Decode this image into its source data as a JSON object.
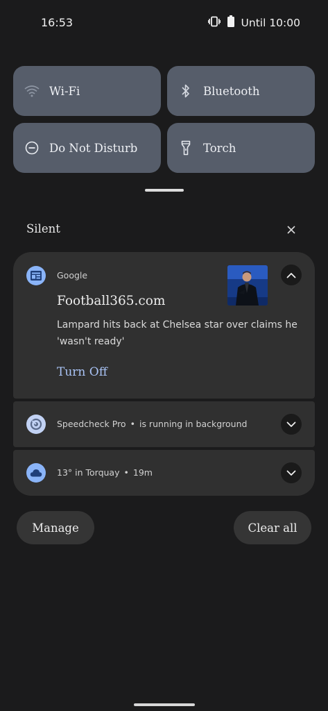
{
  "status_bar": {
    "time": "16:53",
    "battery_text": "Until 10:00",
    "vibrate_icon": "vibrate-icon",
    "battery_icon": "battery-icon"
  },
  "quick_settings": {
    "tiles": [
      {
        "label": "Wi-Fi",
        "icon": "wifi-icon"
      },
      {
        "label": "Bluetooth",
        "icon": "bluetooth-icon"
      },
      {
        "label": "Do Not Disturb",
        "icon": "do-not-disturb-icon"
      },
      {
        "label": "Torch",
        "icon": "flashlight-icon"
      }
    ],
    "tile_color": "#565d6a"
  },
  "notifications": {
    "section_title": "Silent",
    "google": {
      "app_name": "Google",
      "title": "Football365.com",
      "body": "Lampard hits back at Chelsea star over claims he 'wasn't ready'",
      "action": "Turn Off"
    },
    "speedcheck": {
      "app_name": "Speedcheck Pro",
      "separator": "•",
      "text": "is running in background"
    },
    "weather": {
      "text": "13° in Torquay",
      "separator": "•",
      "time": "19m"
    }
  },
  "buttons": {
    "manage": "Manage",
    "clear_all": "Clear all"
  },
  "colors": {
    "background": "#1b1b1c",
    "card": "#303030",
    "accent": "#8ab4f8",
    "action_text": "#a9c3f5"
  }
}
